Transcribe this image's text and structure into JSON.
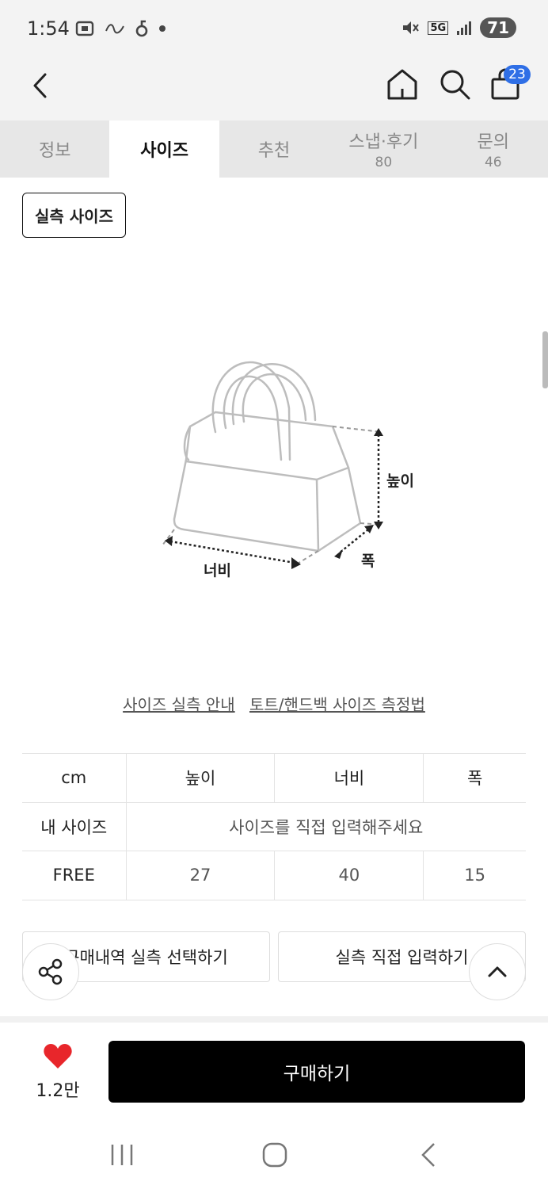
{
  "status_bar": {
    "time": "1:54",
    "network": "5G",
    "battery": "71",
    "icons": [
      "screenshot-icon",
      "app-notification-icon",
      "app-notification-icon",
      "dot-icon",
      "mute-icon",
      "signal-icon"
    ]
  },
  "header": {
    "cart_count": "23",
    "icons": [
      "back-icon",
      "home-icon",
      "search-icon",
      "cart-icon"
    ]
  },
  "tabs": [
    {
      "label": "정보",
      "count": ""
    },
    {
      "label": "사이즈",
      "count": "",
      "active": true
    },
    {
      "label": "추천",
      "count": ""
    },
    {
      "label": "스냅·후기",
      "count": "80"
    },
    {
      "label": "문의",
      "count": "46"
    }
  ],
  "size_section": {
    "chip_label": "실측 사이즈",
    "diagram_labels": {
      "height": "높이",
      "width": "너비",
      "depth": "폭"
    },
    "links": [
      "사이즈 실측 안내",
      "토트/핸드백 사이즈 측정법"
    ]
  },
  "size_table": {
    "headers": [
      "cm",
      "높이",
      "너비",
      "폭"
    ],
    "my_size_label": "내 사이즈",
    "my_size_placeholder": "사이즈를 직접 입력해주세요",
    "rows": [
      {
        "size": "FREE",
        "values": [
          "27",
          "40",
          "15"
        ]
      }
    ]
  },
  "actions": {
    "history_button": "구매내역 실측 선택하기",
    "direct_button": "실측 직접 입력하기"
  },
  "bottom_bar": {
    "like_count": "1.2만",
    "buy_button": "구매하기",
    "like_color": "#e8262b"
  }
}
